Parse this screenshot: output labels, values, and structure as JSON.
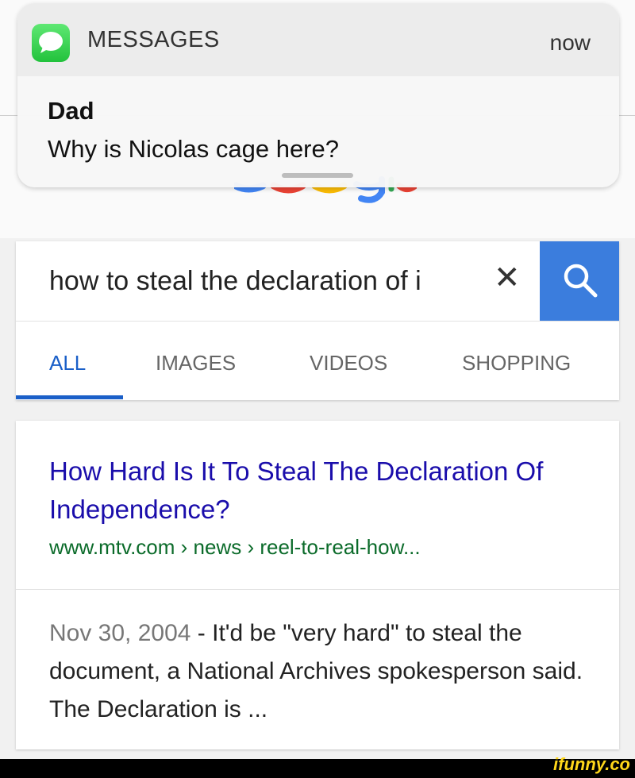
{
  "notification": {
    "app_name": "MESSAGES",
    "time": "now",
    "sender": "Dad",
    "message": "Why is Nicolas cage here?",
    "icon": "messages-icon"
  },
  "search": {
    "query": "how to steal the declaration of i",
    "clear_icon": "clear-icon",
    "search_icon": "search-icon",
    "accent_color": "#3b7ddd"
  },
  "tabs": [
    {
      "label": "ALL",
      "active": true
    },
    {
      "label": "IMAGES",
      "active": false
    },
    {
      "label": "VIDEOS",
      "active": false
    },
    {
      "label": "SHOPPING",
      "active": false
    }
  ],
  "result": {
    "title": "How Hard Is It To Steal The Declaration Of Independence?",
    "url": "www.mtv.com › news › reel-to-real-how...",
    "date": "Nov 30, 2004",
    "snippet": " - It'd be \"very hard\" to steal the document, a National Archives spokesperson said. The Declaration is ..."
  },
  "watermark": "ifunny.co"
}
